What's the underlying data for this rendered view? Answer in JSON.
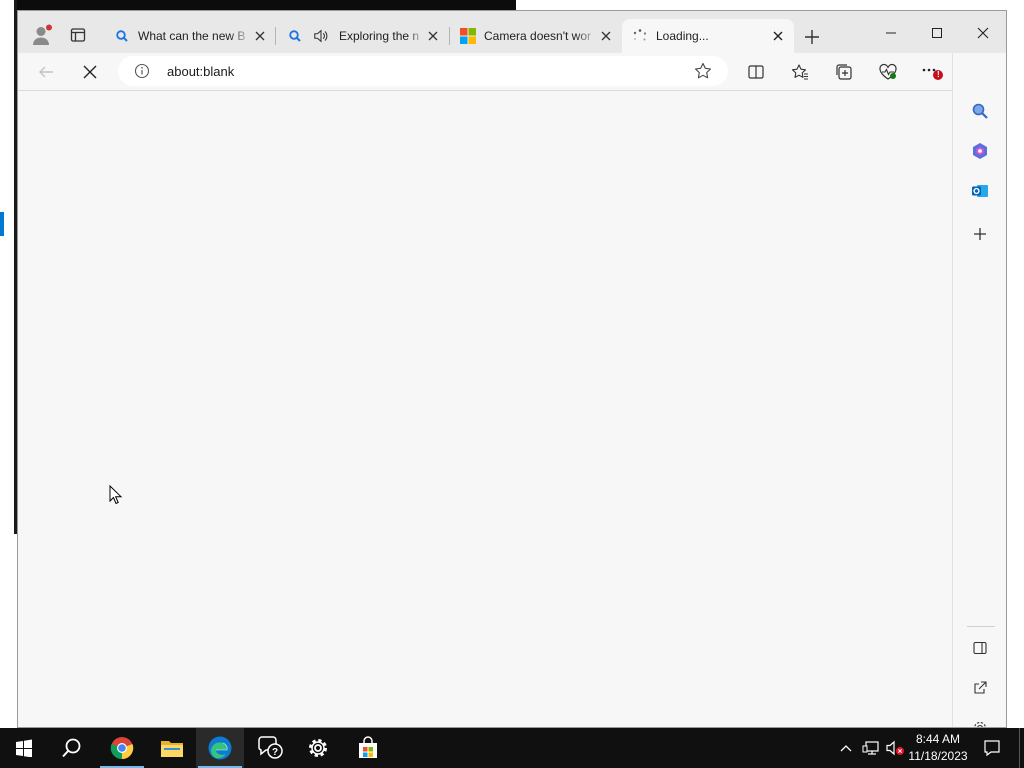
{
  "browser": {
    "tabs": [
      {
        "title": "What can the new B",
        "icon": "search-icon",
        "has_audio": false
      },
      {
        "title": "Exploring the n",
        "icon": "search-icon",
        "has_audio": true,
        "audio_icon": "speaker-icon"
      },
      {
        "title": "Camera doesn't wor",
        "icon": "microsoft-logo-icon",
        "has_audio": false
      },
      {
        "title": "Loading...",
        "icon": "loading-spinner-icon",
        "has_audio": false,
        "active": true
      }
    ],
    "address_bar": {
      "url": "about:blank"
    },
    "notification_badge": "!",
    "accent_color": "#0078d4"
  },
  "taskbar": {
    "apps": [
      "windows-start-icon",
      "search-icon",
      "chrome-icon",
      "file-explorer-icon",
      "edge-icon",
      "feedback-hub-icon",
      "settings-icon",
      "store-icon"
    ],
    "clock": {
      "time": "8:44 AM",
      "date": "11/18/2023"
    }
  }
}
